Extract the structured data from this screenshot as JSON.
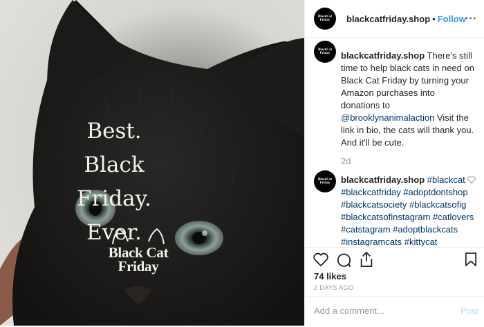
{
  "image": {
    "headline_lines": [
      "Best.",
      "Black Friday.",
      "Ever."
    ],
    "logo_lines": [
      "Black Cat",
      "Friday"
    ]
  },
  "header": {
    "avatar_text": "BlackCat Friday",
    "username": "blackcatfriday.shop",
    "separator": "•",
    "follow_label": "Follow",
    "more_label": "···"
  },
  "caption": {
    "username": "blackcatfriday.shop",
    "text_before": " There's still time to help black cats in need on Black Cat Friday by turning your Amazon purchases into donations to ",
    "mention": "@brooklynanimalaction",
    "text_after": " Visit the link in bio, the cats will thank you. And it'll be cute.",
    "age": "2d"
  },
  "comment": {
    "username": "blackcatfriday.shop",
    "hashtags": "#blackcat #blackcatfriday #adoptdontshop #blackcatsociety #blackcatsofig #blackcatsofinstagram #catlovers #catstagram #adoptblackcats #instagramcats #kittycat #blackcatsclub #blackcatsrule #catsofinstagram #minipanther #blackfriday #blackcatclub #blackcatlove #blackcatsclub"
  },
  "actions": {
    "icons": [
      "heart-icon",
      "comment-icon",
      "share-icon",
      "bookmark-icon"
    ],
    "likes": "74 likes",
    "time_ago": "2 DAYS AGO"
  },
  "add_comment": {
    "placeholder": "Add a comment...",
    "post_label": "Post"
  },
  "colors": {
    "link": "#003569",
    "follow": "#3897f0",
    "post_disabled": "#b2dffc"
  }
}
